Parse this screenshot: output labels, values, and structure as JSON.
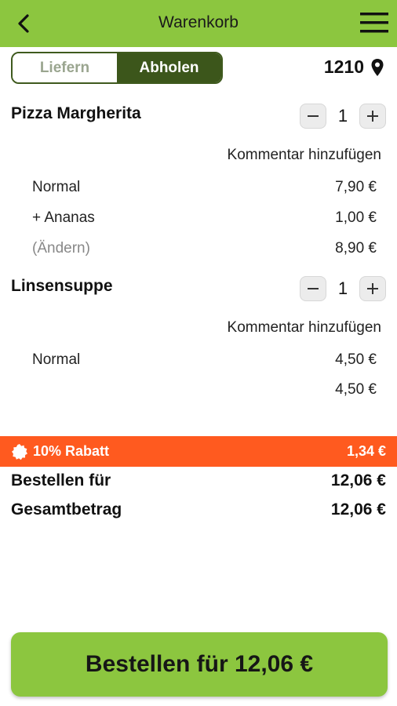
{
  "header": {
    "title": "Warenkorb"
  },
  "delivery_toggle": {
    "deliver": "Liefern",
    "pickup": "Abholen",
    "selected": "Abholen"
  },
  "location": {
    "code": "1210"
  },
  "items": [
    {
      "name": "Pizza Margherita",
      "quantity": "1",
      "comment": "Kommentar hinzufügen",
      "lines": [
        {
          "label": "Normal",
          "price": "7,90 €"
        },
        {
          "label": "+ Ananas",
          "price": "1,00 €"
        },
        {
          "label": "(Ändern)",
          "price": "8,90 €"
        }
      ]
    },
    {
      "name": "Linsensuppe",
      "quantity": "1",
      "comment": "Kommentar hinzufügen",
      "lines": [
        {
          "label": "Normal",
          "price": "4,50 €"
        },
        {
          "label": "",
          "price": "4,50 €"
        }
      ]
    }
  ],
  "discount": {
    "label": "10% Rabatt",
    "amount": "1,34 €"
  },
  "summary": {
    "order_for_label": "Bestellen für",
    "order_for_value": "12,06 €",
    "total_label": "Gesamtbetrag",
    "total_value": "12,06 €"
  },
  "order_button": {
    "label": "Bestellen für 12,06 €"
  },
  "colors": {
    "accent": "#8cc63f",
    "toggle_active": "#3c561b",
    "discount": "#ff5a1f"
  }
}
